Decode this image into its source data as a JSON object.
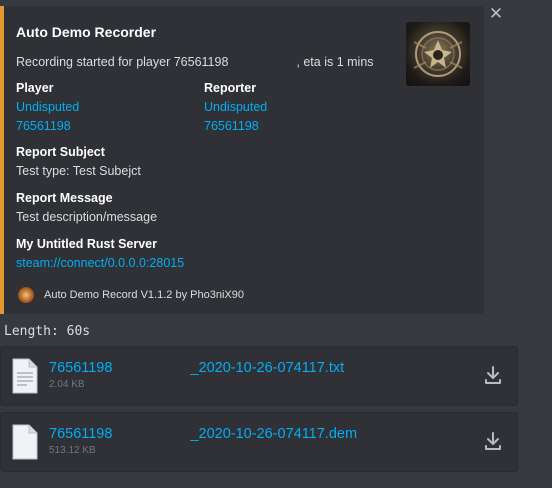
{
  "close_glyph": "✕",
  "embed": {
    "accent_color": "#e09b2d",
    "title": "Auto Demo Recorder",
    "description_part1": "Recording started for player 76561198",
    "description_part2": ", eta is 1 mins",
    "thumbnail_icon": "clan-emblem-thumbnail",
    "player": {
      "name": "Player",
      "line1": "Undisputed",
      "line2": "76561198"
    },
    "reporter": {
      "name": "Reporter",
      "line1": "Undisputed",
      "line2": "76561198"
    },
    "subject": {
      "name": "Report Subject",
      "value": "Test type: Test Subejct"
    },
    "message": {
      "name": "Report Message",
      "value": "Test description/message"
    },
    "server": {
      "name": "My Untitled Rust Server",
      "value": "steam://connect/0.0.0.0:28015"
    },
    "footer": {
      "icon": "radiation-icon",
      "text": "Auto Demo Record V1.1.2 by Pho3niX90"
    }
  },
  "length_text": "Length: 60s",
  "attachments": [
    {
      "name_part1": "76561198",
      "name_part2": "_2020-10-26-074117.txt",
      "size": "2.04 KB"
    },
    {
      "name_part1": "76561198",
      "name_part2": "_2020-10-26-074117.dem",
      "size": "513.12 KB"
    }
  ],
  "colors": {
    "link": "#00aff4",
    "background": "#36393f",
    "embed_bg": "#2f3136"
  }
}
